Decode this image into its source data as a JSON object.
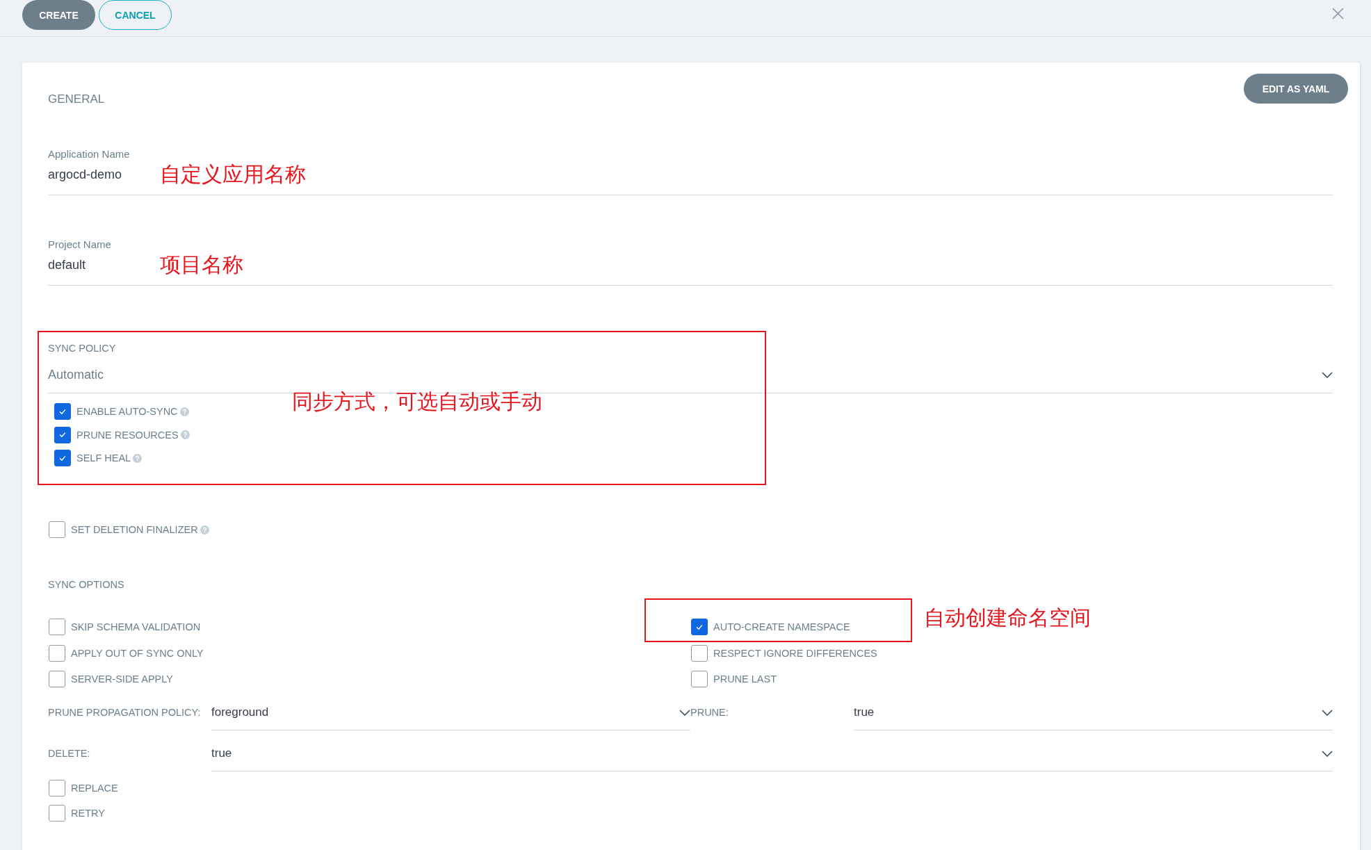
{
  "toolbar": {
    "buttons": [
      {
        "label": "CREATE",
        "kind": "primary"
      },
      {
        "label": "CANCEL",
        "kind": "secondary"
      }
    ]
  },
  "panel": {
    "edit_button": "EDIT AS YAML",
    "general": {
      "heading": "GENERAL",
      "fields": [
        {
          "label": "Application Name",
          "value": "argocd-demo",
          "annotation": "自定义应用名称"
        },
        {
          "label": "Project Name",
          "value": "default",
          "annotation": "项目名称"
        }
      ]
    },
    "sync_policy": {
      "label": "SYNC POLICY",
      "value": "Automatic",
      "highlighted": true,
      "annotation": "同步方式，可选自动或手动",
      "options": [
        {
          "label": "ENABLE AUTO-SYNC",
          "checked": true,
          "help": true
        },
        {
          "label": "PRUNE RESOURCES",
          "checked": true,
          "help": true
        },
        {
          "label": "SELF HEAL",
          "checked": true,
          "help": true
        }
      ]
    },
    "deletion_finalizer": {
      "label": "SET DELETION FINALIZER",
      "checked": false,
      "help": true
    },
    "sync_options": {
      "heading": "SYNC OPTIONS",
      "columns": [
        [
          {
            "label": "SKIP SCHEMA VALIDATION",
            "checked": false,
            "highlighted": false
          },
          {
            "label": "APPLY OUT OF SYNC ONLY",
            "checked": false,
            "highlighted": false
          },
          {
            "label": "SERVER-SIDE APPLY",
            "checked": false,
            "highlighted": false
          }
        ],
        [
          {
            "label": "AUTO-CREATE NAMESPACE",
            "checked": true,
            "highlighted": true,
            "annotation": "自动创建命名空间"
          },
          {
            "label": "RESPECT IGNORE DIFFERENCES",
            "checked": false,
            "highlighted": false
          },
          {
            "label": "PRUNE LAST",
            "checked": false,
            "highlighted": false
          }
        ]
      ],
      "select_rows": [
        [
          {
            "label": "PRUNE PROPAGATION POLICY:",
            "value": "foreground"
          },
          {
            "label": "PRUNE:",
            "value": "true"
          }
        ],
        [
          {
            "label": "DELETE:",
            "value": "true"
          }
        ]
      ],
      "extra_options": [
        {
          "label": "REPLACE",
          "checked": false
        },
        {
          "label": "RETRY",
          "checked": false
        }
      ]
    }
  }
}
